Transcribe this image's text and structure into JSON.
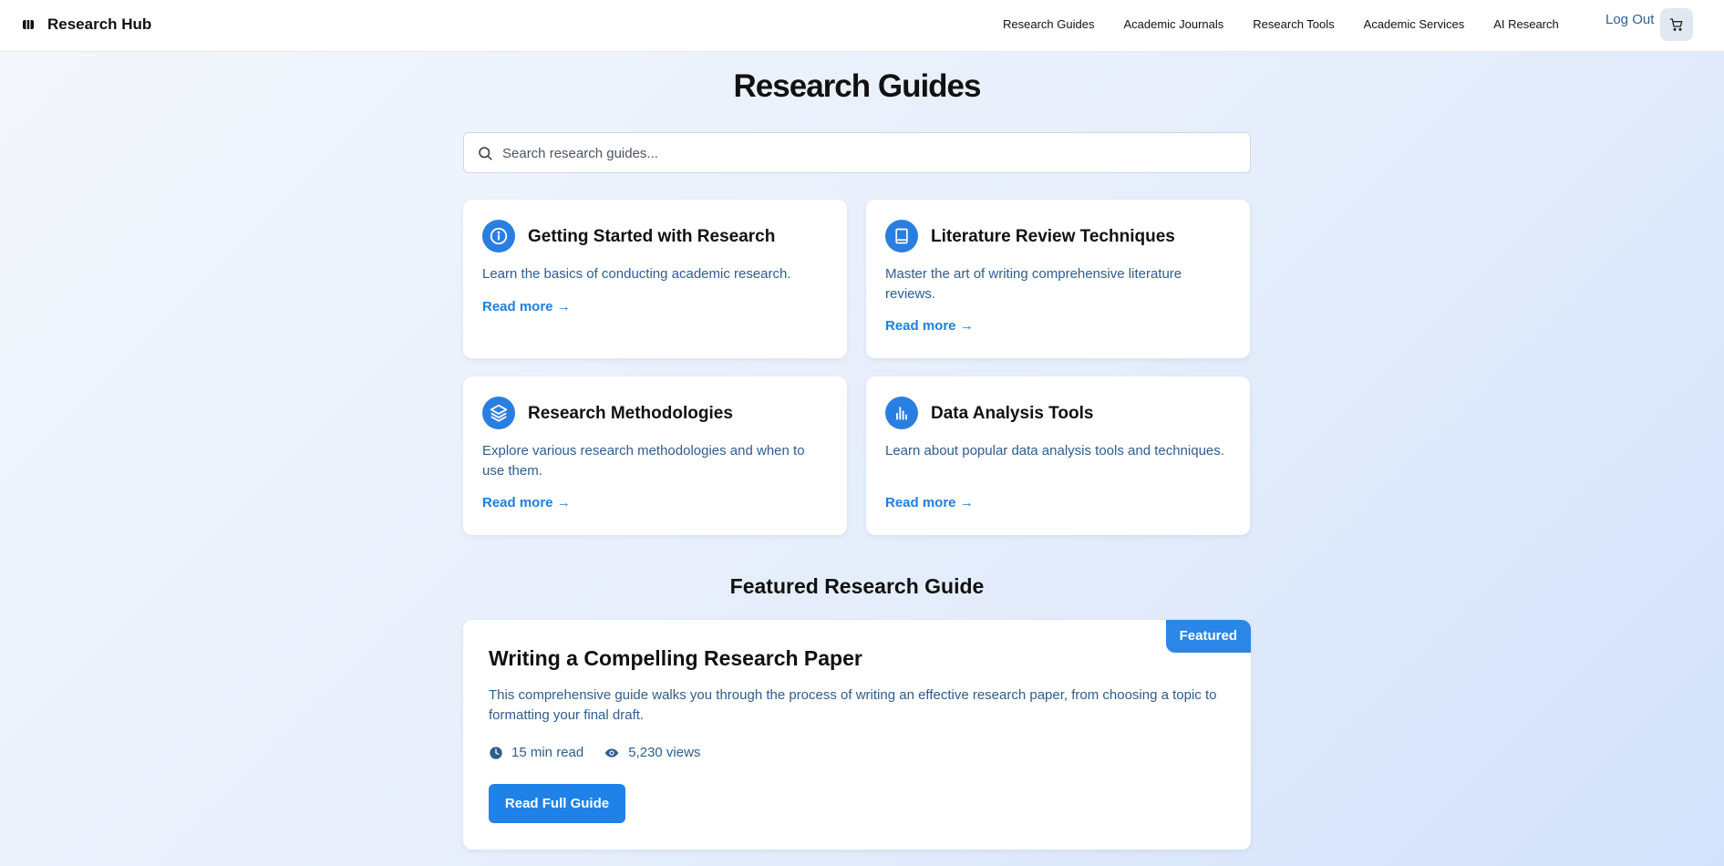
{
  "header": {
    "brand": "Research Hub",
    "nav": [
      "Research Guides",
      "Academic Journals",
      "Research Tools",
      "Academic Services",
      "AI Research"
    ],
    "logout": "Log Out"
  },
  "page": {
    "title": "Research Guides",
    "search_placeholder": "Search research guides..."
  },
  "cards": [
    {
      "icon": "info-icon",
      "title": "Getting Started with Research",
      "desc": "Learn the basics of conducting academic research.",
      "link": "Read more →"
    },
    {
      "icon": "book-icon",
      "title": "Literature Review Techniques",
      "desc": "Master the art of writing comprehensive literature reviews.",
      "link": "Read more →"
    },
    {
      "icon": "layers-icon",
      "title": "Research Methodologies",
      "desc": "Explore various research methodologies and when to use them.",
      "link": "Read more →"
    },
    {
      "icon": "bar-chart-icon",
      "title": "Data Analysis Tools",
      "desc": "Learn about popular data analysis tools and techniques.",
      "link": "Read more →"
    }
  ],
  "featured": {
    "section_title": "Featured Research Guide",
    "badge": "Featured",
    "title": "Writing a Compelling Research Paper",
    "desc": "This comprehensive guide walks you through the process of writing an effective research paper, from choosing a topic to formatting your final draft.",
    "read_time": "15 min read",
    "views": "5,230 views",
    "button": "Read Full Guide"
  },
  "colors": {
    "accent": "#1f82e8",
    "text_blue": "#2e5d8e",
    "icon_bg": "#2a7ee0"
  }
}
